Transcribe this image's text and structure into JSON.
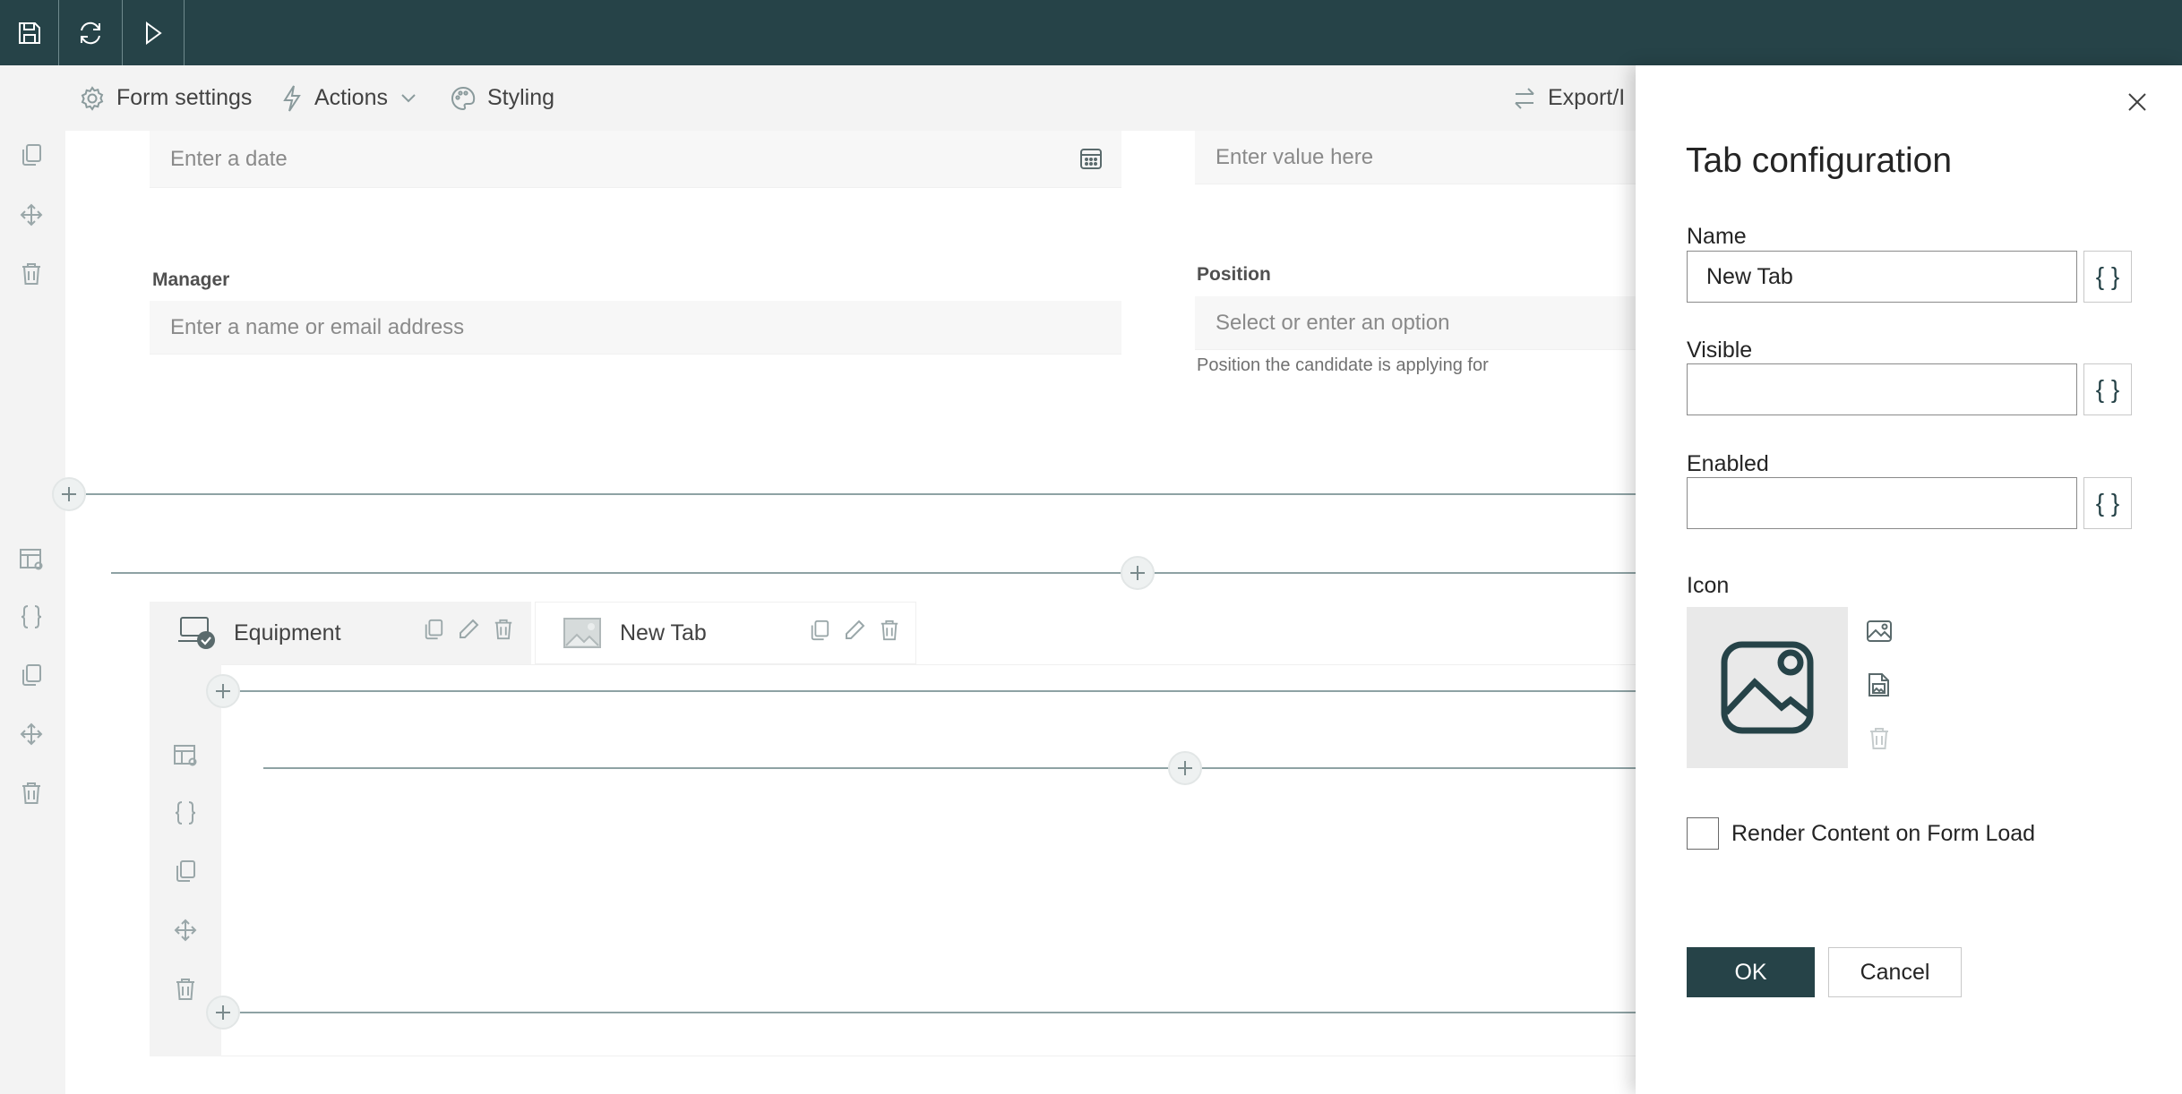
{
  "toolbar": {
    "form_settings": "Form settings",
    "actions": "Actions",
    "styling": "Styling",
    "export_import": "Export/I"
  },
  "form": {
    "date_placeholder": "Enter a date",
    "value_placeholder": "Enter value here",
    "manager_label": "Manager",
    "manager_placeholder": "Enter a name or email address",
    "position_label": "Position",
    "position_placeholder": "Select or enter an option",
    "position_helper": "Position the candidate is applying for"
  },
  "tabs": [
    {
      "label": "Equipment"
    },
    {
      "label": "New Tab"
    }
  ],
  "dialog": {
    "title": "Tab configuration",
    "name_label": "Name",
    "name_value": "New Tab",
    "visible_label": "Visible",
    "visible_value": "",
    "enabled_label": "Enabled",
    "enabled_value": "",
    "expr_button": "{ }",
    "icon_label": "Icon",
    "render_content_label": "Render Content on Form Load",
    "render_content_checked": false,
    "ok_label": "OK",
    "cancel_label": "Cancel"
  },
  "colors": {
    "topbar": "#264348",
    "primary_button": "#264348",
    "gutter": "#f3f3f3",
    "divider": "#8ea2a4"
  },
  "icons": [
    "save-icon",
    "refresh-icon",
    "run-icon",
    "gear-icon",
    "lightning-icon",
    "chevron-down-icon",
    "palette-icon",
    "swap-icon",
    "close-icon",
    "calendar-icon",
    "copy-icon",
    "move-icon",
    "trash-icon",
    "table-settings-icon",
    "braces-icon",
    "plus-icon",
    "edit-icon",
    "image-icon",
    "laptop-check-icon"
  ]
}
